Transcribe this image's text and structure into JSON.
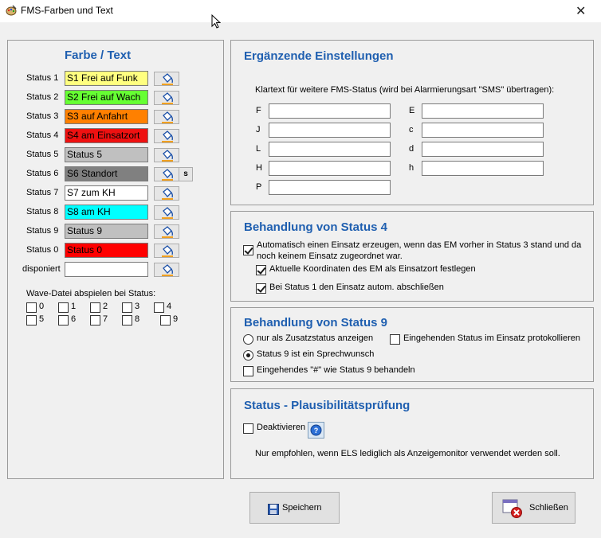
{
  "window": {
    "title": "FMS-Farben und Text",
    "close_label": "✕"
  },
  "left": {
    "title": "Farbe / Text",
    "statuses": [
      {
        "label": "Status 1",
        "text": "S1 Frei auf Funk",
        "bg": "#ffff80",
        "fg": "#000000"
      },
      {
        "label": "Status 2",
        "text": "S2 Frei auf Wach",
        "bg": "#66ff33",
        "fg": "#000000"
      },
      {
        "label": "Status 3",
        "text": "S3 auf Anfahrt",
        "bg": "#ff8000",
        "fg": "#000000"
      },
      {
        "label": "Status 4",
        "text": "S4 am Einsatzort",
        "bg": "#ee1111",
        "fg": "#000000"
      },
      {
        "label": "Status 5",
        "text": "Status 5",
        "bg": "#c0c0c0",
        "fg": "#000000"
      },
      {
        "label": "Status 6",
        "text": "S6 Standort",
        "bg": "#808080",
        "fg": "#000000"
      },
      {
        "label": "Status 7",
        "text": "S7 zum KH",
        "bg": "#ffffff",
        "fg": "#000000"
      },
      {
        "label": "Status 8",
        "text": "S8 am KH",
        "bg": "#00ffff",
        "fg": "#000000"
      },
      {
        "label": "Status 9",
        "text": "Status 9",
        "bg": "#c0c0c0",
        "fg": "#000000"
      },
      {
        "label": "Status 0",
        "text": "Status 0",
        "bg": "#ff0000",
        "fg": "#000000"
      },
      {
        "label": "disponiert",
        "text": "",
        "bg": "#ffffff",
        "fg": "#000000"
      }
    ],
    "s_button": "s",
    "wave_label": "Wave-Datei abspielen bei Status:",
    "wave_items": [
      "0",
      "1",
      "2",
      "3",
      "4",
      "5",
      "6",
      "7",
      "8",
      "9"
    ]
  },
  "extra": {
    "title": "Ergänzende Einstellungen",
    "description": "Klartext für weitere FMS-Status (wird bei Alarmierungsart \"SMS\" übertragen):",
    "left_labels": [
      "F",
      "J",
      "L",
      "H",
      "P"
    ],
    "right_labels": [
      "E",
      "c",
      "d",
      "h"
    ]
  },
  "status4": {
    "title": "Behandlung von Status 4",
    "auto_line1": "Automatisch einen Einsatz erzeugen, wenn  das EM vorher in Status 3 stand und da",
    "auto_line2": "noch keinem Einsatz zugeordnet war.",
    "coords": "Aktuelle Koordinaten des EM als Einsatzort festlegen",
    "close1": "Bei Status 1 den Einsatz autom. abschließen"
  },
  "status9": {
    "title": "Behandlung von Status 9",
    "radio_zusatz": "nur als Zusatzstatus anzeigen",
    "radio_sprech": "Status 9 ist ein Sprechwunsch",
    "protokoll": "Eingehenden Status im Einsatz protokollieren",
    "hash": "Eingehendes \"#\" wie Status 9 behandeln"
  },
  "plaus": {
    "title": "Status - Plausibilitätsprüfung",
    "deactivate": "Deaktivieren",
    "note": "Nur empfohlen, wenn ELS lediglich als Anzeigemonitor verwendet werden soll."
  },
  "buttons": {
    "save": "Speichern",
    "close": "Schließen"
  }
}
